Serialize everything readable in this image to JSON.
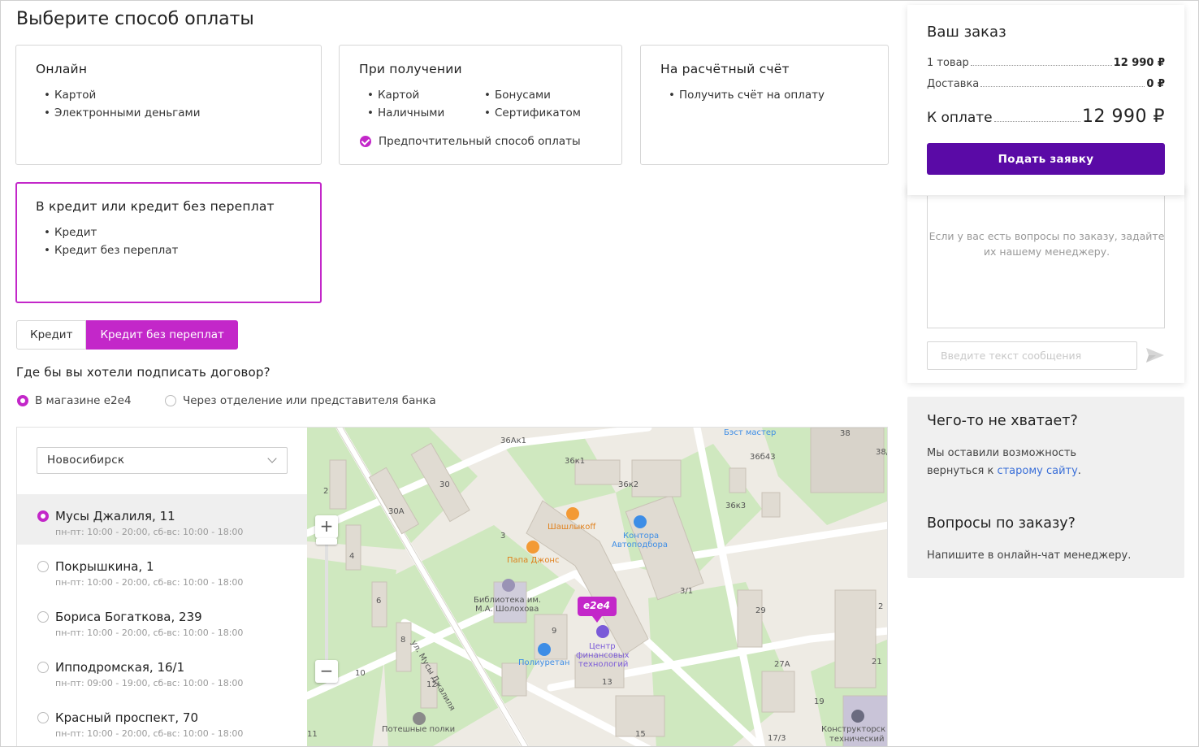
{
  "page": {
    "title": "Выберите способ оплаты"
  },
  "payment_methods": {
    "online": {
      "title": "Онлайн",
      "items": [
        "Картой",
        "Электронными деньгами"
      ]
    },
    "on_delivery": {
      "title": "При получении",
      "items_left": [
        "Картой",
        "Наличными"
      ],
      "items_right": [
        "Бонусами",
        "Сертификатом"
      ],
      "preferred_label": "Предпочтительный способ оплаты"
    },
    "invoice": {
      "title": "На расчётный счёт",
      "items": [
        "Получить счёт на оплату"
      ]
    },
    "credit": {
      "title": "В кредит или кредит без переплат",
      "items": [
        "Кредит",
        "Кредит без переплат"
      ]
    }
  },
  "credit_tabs": {
    "credit": "Кредит",
    "installment": "Кредит без переплат",
    "active": "installment"
  },
  "signing": {
    "question": "Где бы вы хотели подписать договор?",
    "options": [
      "В магазине e2e4",
      "Через отделение или представителя банка"
    ],
    "selected": 0
  },
  "stores": {
    "city": "Новосибирск",
    "selected": 0,
    "list": [
      {
        "name": "Мусы Джалиля, 11",
        "hours": "пн-пт: 10:00 - 20:00, сб-вс: 10:00 - 18:00"
      },
      {
        "name": "Покрышкина, 1",
        "hours": "пн-пт: 10:00 - 20:00, сб-вс: 10:00 - 18:00"
      },
      {
        "name": "Бориса Богаткова, 239",
        "hours": "пн-пт: 10:00 - 20:00, сб-вс: 10:00 - 18:00"
      },
      {
        "name": "Ипподромская, 16/1",
        "hours": "пн-пт: 09:00 - 19:00, сб-вс: 10:00 - 18:00"
      },
      {
        "name": "Красный проспект, 70",
        "hours": "пн-пт: 10:00 - 20:00, сб-вс: 10:00 - 18:00"
      }
    ]
  },
  "map": {
    "zoom_in": "+",
    "zoom_out": "−",
    "brand_pin": "e2e4",
    "street": "ул. Мусы Джалиля",
    "pois": {
      "shashlykoff": "Шашлыкoff",
      "papa_johns": "Папа Джонс",
      "kontora_1": "Контора",
      "kontora_2": "Автоподбора",
      "library_1": "Библиотека им.",
      "library_2": "М.А. Шолохова",
      "center_1": "Центр",
      "center_2": "финансовых",
      "center_3": "технологий",
      "poliuretan": "Полиуретан",
      "best_master": "Бэст мастер",
      "poteshnye": "Потешные полки",
      "konstr_1": "Конструкторск",
      "konstr_2": "технический"
    },
    "house_numbers": {
      "h36ak1": "36Ак1",
      "h36k1": "36к1",
      "h36k2": "36к2",
      "h36b43": "36б43",
      "h36k3": "36к3",
      "h38a": "38",
      "h38b": "38/",
      "h30": "30",
      "h30a": "30А",
      "h2": "2",
      "h3": "3",
      "h4": "4",
      "h6": "6",
      "h8": "8",
      "h9": "9",
      "h10": "10",
      "h12": "12",
      "h13": "13",
      "h29": "29",
      "h27a": "27А",
      "h21": "21",
      "h19": "19",
      "h17": "17/3",
      "h15": "15",
      "h11": "11",
      "h31": "3/1",
      "h2e": "2"
    }
  },
  "order": {
    "title": "Ваш заказ",
    "items_label": "1 товар",
    "items_value": "12 990 ₽",
    "delivery_label": "Доставка",
    "delivery_value": "0 ₽",
    "total_label": "К оплате",
    "total_value": "12 990 ₽",
    "submit": "Подать заявку"
  },
  "chat": {
    "hint": "Если у вас есть вопросы по заказу, задайте их нашему менеджеру.",
    "placeholder": "Введите текст сообщения"
  },
  "info": {
    "missing_title": "Чего-то не хватает?",
    "missing_text_1": "Мы оставили возможность",
    "missing_text_2": "вернуться к",
    "old_site_link": "старому сайту",
    "missing_text_3": ".",
    "questions_title": "Вопросы по заказу?",
    "questions_text": "Напишите в онлайн-чат менеджеру."
  },
  "colors": {
    "accent": "#c327c9",
    "primary_button": "#5a0aa6",
    "link": "#3a6fd8"
  }
}
